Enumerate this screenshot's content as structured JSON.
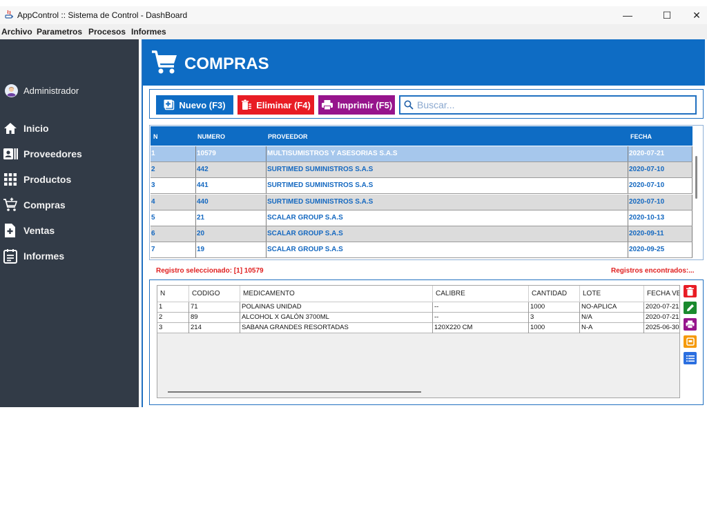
{
  "window": {
    "title": "AppControl :: Sistema de Control - DashBoard",
    "minimize_glyph": "—",
    "maximize_glyph": "☐",
    "close_glyph": "✕"
  },
  "menu": [
    "Archivo",
    "Parametros",
    "Procesos",
    "Informes"
  ],
  "sidebar": {
    "user": "Administrador",
    "items": [
      {
        "label": "Inicio",
        "icon": "home-icon"
      },
      {
        "label": "Proveedores",
        "icon": "contacts-icon"
      },
      {
        "label": "Productos",
        "icon": "grid-icon"
      },
      {
        "label": "Compras",
        "icon": "cart-add-icon"
      },
      {
        "label": "Ventas",
        "icon": "add-document-icon"
      },
      {
        "label": "Informes",
        "icon": "report-icon"
      }
    ]
  },
  "header": {
    "title": "COMPRAS",
    "icon": "cart-icon"
  },
  "toolbar": {
    "nuevo": "Nuevo (F3)",
    "eliminar": "Eliminar (F4)",
    "imprimir": "Imprimir (F5)",
    "search_placeholder": "Buscar..."
  },
  "colors": {
    "accent": "#0e6cc4",
    "sidebar": "#323b47",
    "nuevo": "#0e6cc4",
    "eliminar": "#e81c24",
    "imprimir": "#96148c",
    "selected_row": "#a6c7ec",
    "alt_row": "#dcdcdc",
    "status_text": "#e02020"
  },
  "main_table": {
    "columns": [
      "N",
      "NUMERO",
      "PROVEEDOR",
      "FECHA"
    ],
    "rows": [
      [
        "1",
        "10579",
        "MULTISUMISTROS Y ASESORIAS S.A.S",
        "2020-07-21"
      ],
      [
        "2",
        "442",
        "SURTIMED SUMINISTROS S.A.S",
        "2020-07-10"
      ],
      [
        "3",
        "441",
        "SURTIMED SUMINISTROS S.A.S",
        "2020-07-10"
      ],
      [
        "4",
        "440",
        "SURTIMED SUMINISTROS S.A.S",
        "2020-07-10"
      ],
      [
        "5",
        "21",
        "SCALAR GROUP S.A.S",
        "2020-10-13"
      ],
      [
        "6",
        "20",
        "SCALAR GROUP S.A.S",
        "2020-09-11"
      ],
      [
        "7",
        "19",
        "SCALAR GROUP S.A.S",
        "2020-09-25"
      ]
    ]
  },
  "status": {
    "selected": "Registro seleccionado: [1] 10579",
    "found": "Registros encontrados:..."
  },
  "detail_table": {
    "columns": [
      "N",
      "CODIGO",
      "MEDICAMENTO",
      "CALIBRE",
      "CANTIDAD",
      "LOTE",
      "FECHA VENCIMIENTO"
    ],
    "rows": [
      [
        "1",
        "71",
        "POLAINAS UNIDAD",
        "--",
        "1000",
        "NO-APLICA",
        "2020-07-21"
      ],
      [
        "2",
        "89",
        "ALCOHOL X GALÓN 3700ML",
        "--",
        "3",
        "N/A",
        "2020-07-21"
      ],
      [
        "3",
        "214",
        "SABANA GRANDES RESORTADAS",
        "120X220 CM",
        "1000",
        "N-A",
        "2025-06-30"
      ]
    ]
  },
  "detail_actions": [
    {
      "name": "delete-item-button",
      "icon": "trash-icon"
    },
    {
      "name": "edit-item-button",
      "icon": "pencil-icon"
    },
    {
      "name": "print-item-button",
      "icon": "printer-icon"
    },
    {
      "name": "archive-item-button",
      "icon": "box-icon"
    },
    {
      "name": "list-item-button",
      "icon": "list-icon"
    }
  ]
}
